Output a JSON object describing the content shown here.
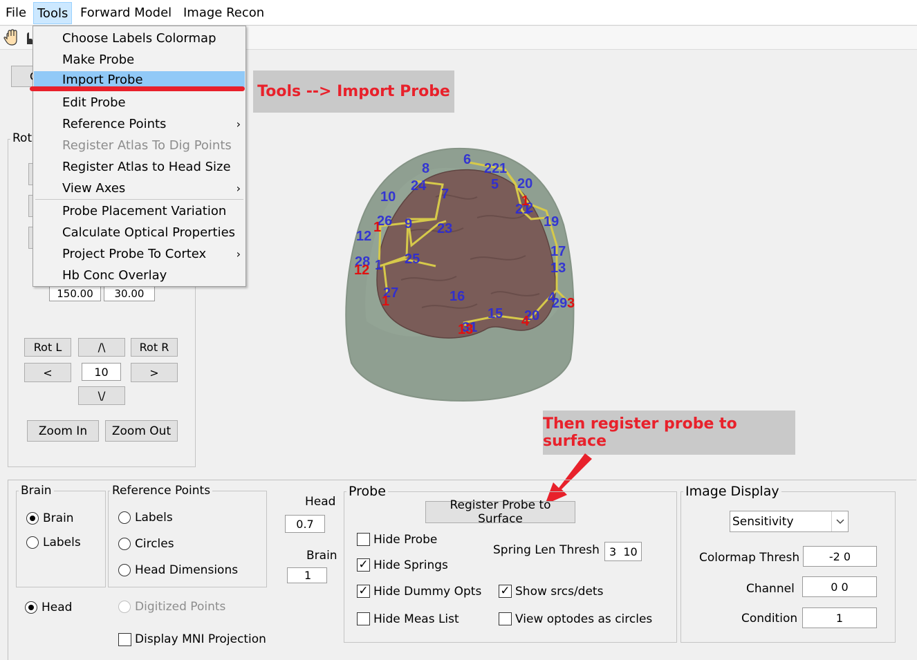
{
  "menubar": {
    "items": [
      "File",
      "Tools",
      "Forward Model",
      "Image Recon"
    ]
  },
  "tools_menu": {
    "items": [
      {
        "label": "Choose Labels Colormap"
      },
      {
        "label": "Make Probe"
      },
      {
        "label": "Import Probe"
      },
      {
        "label": "Edit Probe"
      },
      {
        "label": "Reference Points"
      },
      {
        "label": "Register Atlas To Dig Points"
      },
      {
        "label": "Register Atlas to Head Size"
      },
      {
        "label": "View Axes"
      },
      {
        "label": "Probe Placement Variation"
      },
      {
        "label": "Calculate Optical Properties"
      },
      {
        "label": "Project Probe To Cortex"
      },
      {
        "label": "Hb Conc Overlay"
      }
    ],
    "submenu_arrow": "›"
  },
  "annotations": {
    "import": "Tools --> Import Probe",
    "register": "Then register probe to surface"
  },
  "rotation": {
    "group_title_visible": "Rot",
    "partial_button": "C",
    "az_value": "150.00",
    "el_value": "30.00",
    "rot_left": "Rot L",
    "up": "/\\",
    "rot_right": "Rot R",
    "left": "<",
    "step_value": "10",
    "right": ">",
    "down": "\\/",
    "zoom_in": "Zoom In",
    "zoom_out": "Zoom Out"
  },
  "brain_group": {
    "title": "Brain",
    "options": [
      "Brain",
      "Labels"
    ],
    "selected": "Brain",
    "head_option": "Head"
  },
  "refpoints_group": {
    "title": "Reference Points",
    "options": [
      "Labels",
      "Circles",
      "Head Dimensions"
    ],
    "digitized": "Digitized Points",
    "mni": "Display MNI Projection"
  },
  "opacity": {
    "head_label": "Head",
    "head_value": "0.7",
    "brain_label": "Brain",
    "brain_value": "1"
  },
  "probe_group": {
    "title": "Probe",
    "register_button": "Register Probe to Surface",
    "hide_probe": "Hide Probe",
    "hide_springs": "Hide Springs",
    "hide_dummy": "Hide Dummy Opts",
    "hide_meas": "Hide Meas List",
    "spring_label": "Spring Len Thresh",
    "spring_value": "3  10",
    "show_srcs": "Show srcs/dets",
    "view_circles": "View optodes as circles",
    "check_mark": "✓"
  },
  "image_display": {
    "title": "Image Display",
    "select_value": "Sensitivity",
    "colormap_label": "Colormap Thresh",
    "colormap_value": "-2 0",
    "channel_label": "Channel",
    "channel_value": "0 0",
    "condition_label": "Condition",
    "condition_value": "1"
  },
  "probe_numbers": {
    "blue": [
      "6",
      "8",
      "22",
      "1",
      "5",
      "20",
      "24",
      "7",
      "10",
      "2",
      "21",
      "26",
      "9",
      "19",
      "23",
      "12",
      "17",
      "28",
      "1",
      "25",
      "13",
      "27",
      "4",
      "29",
      "16",
      "15",
      "20",
      "31"
    ],
    "red": [
      "1",
      "1",
      "12",
      "1",
      "3",
      "4",
      "13"
    ]
  },
  "colors": {
    "annotation_red": "#e8212b",
    "menu_highlight": "#91c9f7",
    "probe_blue": "#2b2bd8",
    "probe_red": "#e01010"
  }
}
